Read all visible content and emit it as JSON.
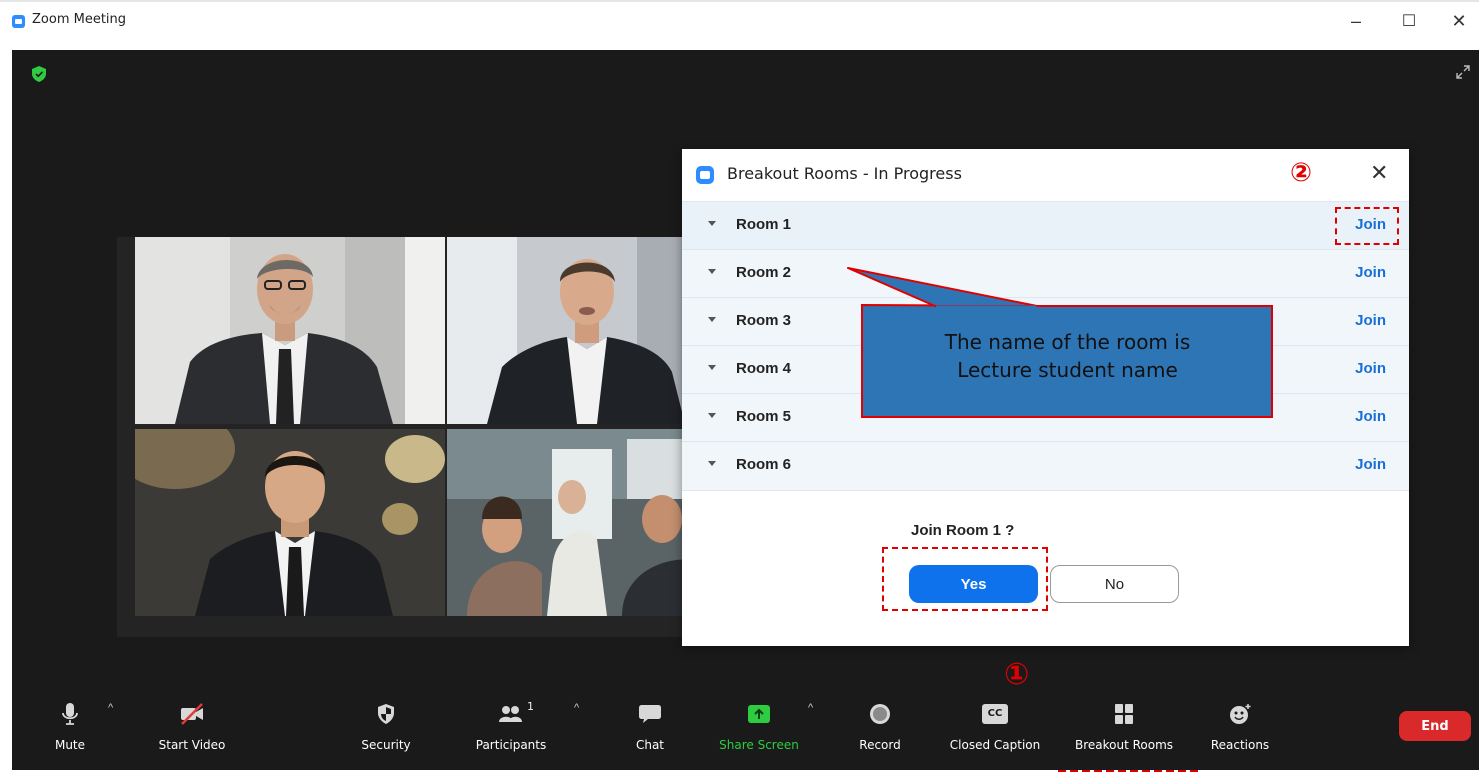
{
  "window": {
    "title": "Zoom Meeting",
    "controls": {
      "minimize": "–",
      "maximize": "☐",
      "close": "✕"
    }
  },
  "dialog": {
    "title": "Breakout Rooms - In Progress",
    "close": "✕",
    "step_marker": "②",
    "rooms": [
      {
        "name": "Room 1",
        "join": "Join"
      },
      {
        "name": "Room 2",
        "join": "Join"
      },
      {
        "name": "Room 3",
        "join": "Join"
      },
      {
        "name": "Room 4",
        "join": "Join"
      },
      {
        "name": "Room 5",
        "join": "Join"
      },
      {
        "name": "Room 6",
        "join": "Join"
      }
    ],
    "confirm_question": "Join Room 1 ?",
    "yes": "Yes",
    "no": "No"
  },
  "callout": {
    "line1": "The name of the room is",
    "line2": "Lecture student name"
  },
  "toolbar": {
    "step_marker": "①",
    "mute": "Mute",
    "start_video": "Start Video",
    "security": "Security",
    "participants": "Participants",
    "participants_count": "1",
    "chat": "Chat",
    "share_screen": "Share Screen",
    "record": "Record",
    "closed_caption": "Closed Caption",
    "closed_caption_icon_text": "CC",
    "breakout_rooms": "Breakout Rooms",
    "reactions": "Reactions",
    "end": "End"
  },
  "colors": {
    "accent": "#0e72ed",
    "join_link": "#1a6fd6",
    "highlight": "#e00000",
    "end_button": "#d9292b",
    "share_screen": "#2ecc40",
    "callout_fill": "#2e75b6"
  }
}
